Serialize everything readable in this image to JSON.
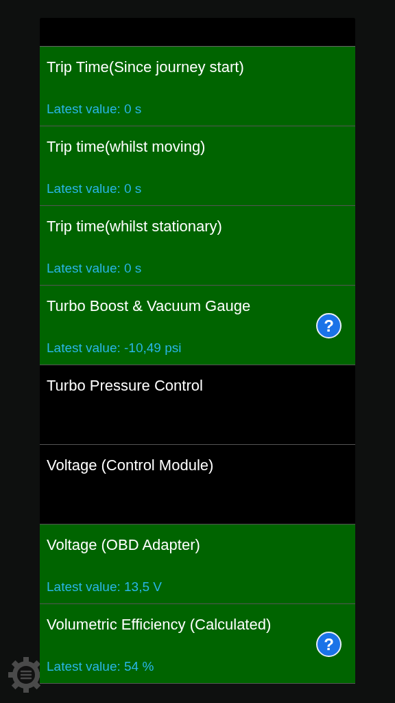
{
  "items": [
    {
      "title": "Trip Time(Since journey start)",
      "value": "Latest value: 0 s",
      "active": true,
      "help": false
    },
    {
      "title": "Trip time(whilst moving)",
      "value": "Latest value: 0 s",
      "active": true,
      "help": false
    },
    {
      "title": "Trip time(whilst stationary)",
      "value": "Latest value: 0 s",
      "active": true,
      "help": false
    },
    {
      "title": "Turbo Boost & Vacuum Gauge",
      "value": "Latest value: -10,49 psi",
      "active": true,
      "help": true,
      "help_label": "?"
    },
    {
      "title": "Turbo Pressure Control",
      "active": false,
      "help": false
    },
    {
      "title": "Voltage (Control Module)",
      "active": false,
      "help": false
    },
    {
      "title": "Voltage (OBD Adapter)",
      "value": "Latest value: 13,5 V",
      "active": true,
      "help": false
    },
    {
      "title": "Volumetric Efficiency (Calculated)",
      "value": "Latest value: 54 %",
      "active": true,
      "help": true,
      "help_label": "?"
    }
  ]
}
